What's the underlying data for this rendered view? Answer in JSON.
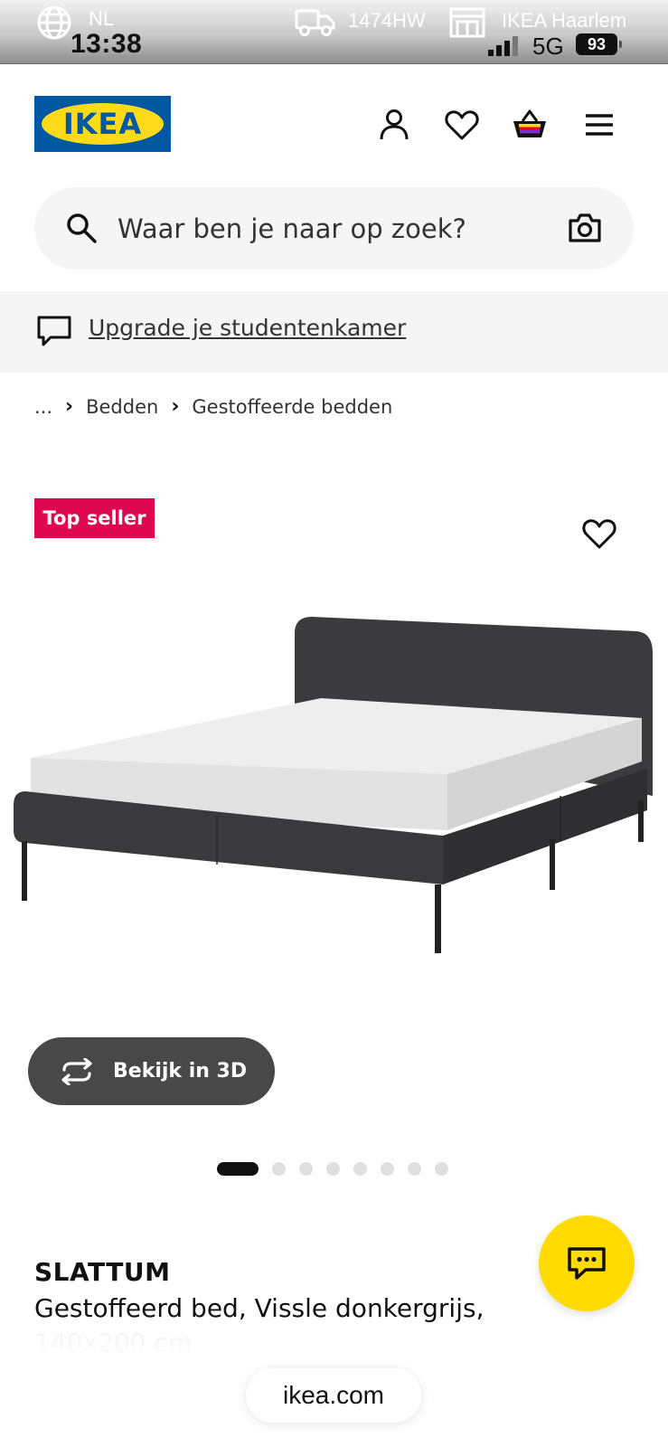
{
  "status_bar": {
    "language": "NL",
    "time": "13:38",
    "postal_code": "1474HW",
    "store": "IKEA Haarlem",
    "network": "5G",
    "battery": "93"
  },
  "header": {
    "logo_text": "IKEA",
    "brand_colors": {
      "blue": "#0058a3",
      "yellow": "#ffda1a"
    },
    "icons": [
      "user-icon",
      "heart-icon",
      "basket-icon",
      "menu-icon"
    ]
  },
  "search": {
    "placeholder": "Waar ben je naar op zoek?"
  },
  "banner": {
    "text": "Upgrade je studentenkamer"
  },
  "breadcrumb": {
    "items": [
      "...",
      "Bedden",
      "Gestoffeerde bedden"
    ]
  },
  "product": {
    "badge": "Top seller",
    "badge_color": "#e00751",
    "view_3d_label": "Bekijk in 3D",
    "image_count": 8,
    "active_image": 1,
    "name": "SLATTUM",
    "description": "Gestoffeerd bed, Vissle donkergrijs, 140x200 cm"
  },
  "chat": {
    "color": "#ffdb00"
  },
  "browser": {
    "url": "ikea.com"
  }
}
